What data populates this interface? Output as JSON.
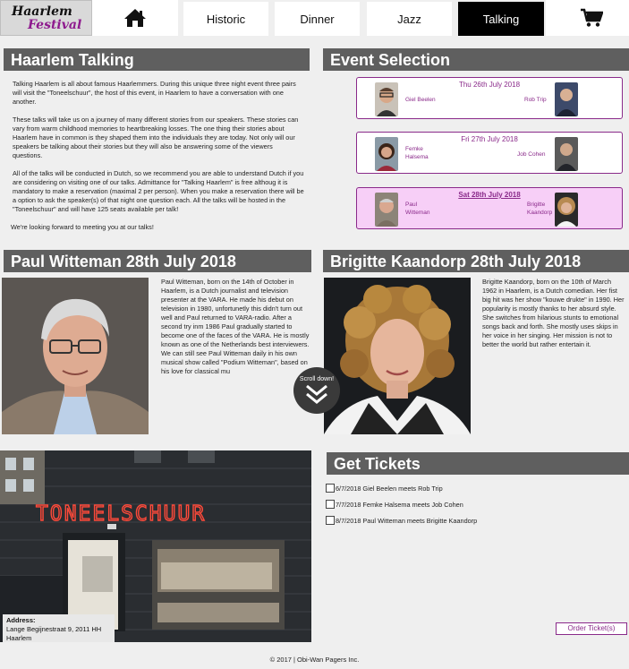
{
  "header": {
    "logo_line1": "Haarlem",
    "logo_line2": "Festival",
    "nav": {
      "historic": "Historic",
      "dinner": "Dinner",
      "jazz": "Jazz",
      "talking": "Talking"
    },
    "icons": {
      "home": "home-icon",
      "cart": "shopping-cart-icon"
    }
  },
  "intro": {
    "title": "Haarlem Talking",
    "p1": "Talking Haarlem is all about famous Haarlemmers. During this unique three night event three pairs will visit the \"Toneelschuur\", the host of this event, in Haarlem to have a conversation with one another.",
    "p2": "These talks will take us on a journey of many different stories from our speakers. These stories can vary from warm childhood memories to heartbreaking losses. The one thing their stories about Haarlem have in common is they shaped them into the individuals they are today. Not only will our speakers be talking about their stories but they will also be answering some of the viewers questions.",
    "p3": "All of the talks will be conducted in Dutch, so we recommend you are able to understand Dutch if you are considering on visiting one of our talks. Admittance for \"Talking Haarlem\" is free althoug it is mandatory to make a reservation (maximal 2 per person). When you make a reservation there will be a option to ask the speaker(s) of that night one question each. All the talks will be hosted in the \"Toneelschuur\" and will have 125 seats available per talk!",
    "p4": "We're looking forward to meeting you at our talks!"
  },
  "events": {
    "title": "Event Selection",
    "items": [
      {
        "date": "Thu 26th July 2018",
        "left": "Giel Beelen",
        "right": "Rob Trip"
      },
      {
        "date": "Fri 27th July 2018",
        "left": "Femke Halsema",
        "right": "Job Cohen"
      },
      {
        "date": "Sat 28th July 2018",
        "left": "Paul Witteman",
        "right": "Brigitte Kaandorp"
      }
    ]
  },
  "paul": {
    "title": "Paul Witteman 28th July 2018",
    "bio": "Paul Witteman, born on the 14th of October in Haarlem, is a Dutch journalist and television presenter at the VARA. He made his debut on television in 1980, unfortunetly this didn't turn out well and Paul returned to VARA-radio. After a second try inm 1986 Paul gradually started to become one of the faces of the VARA. He is mostly known as one of the Netherlands best interviewers. We can still see Paul Witteman daily in his own musical show called \"Podium Witteman\", based on his love for classical mu"
  },
  "brigitte": {
    "title": "Brigitte Kaandorp 28th July 2018",
    "bio": "Brigitte Kaandorp, born on the 10th of March 1962 in Haarlem, is a Dutch comedian. Her fist big hit was her show \"kouwe drukte\" in 1990. Her popularity is mostly thanks to her absurd style. She switches from hilarious stunts to emotional songs back and forth. She mostly uses skips in her voice in her singing. Her mission is not to better the world but rather entertain it."
  },
  "scroll": {
    "label": "Scroll down!"
  },
  "venue": {
    "sign": "TONEELSCHUUR",
    "address_label": "Address:",
    "address_value": "Lange Begijnestraat 9, 2011 HH Haarlem"
  },
  "tickets": {
    "title": "Get Tickets",
    "items": [
      "6/7/2018 Giel Beelen meets Rob Trip",
      "7/7/2018 Femke Halsema meets Job Cohen",
      "8/7/2018 Paul Witteman meets Brigitte Kaandorp"
    ],
    "order_label": "Order Ticket(s)"
  },
  "footer": {
    "text": "© 2017 | Obi-Wan Pagers Inc."
  },
  "colors": {
    "accent": "#8a2a8a",
    "panel_title": "#5f5f5f",
    "selected_event": "#f7cff7"
  }
}
